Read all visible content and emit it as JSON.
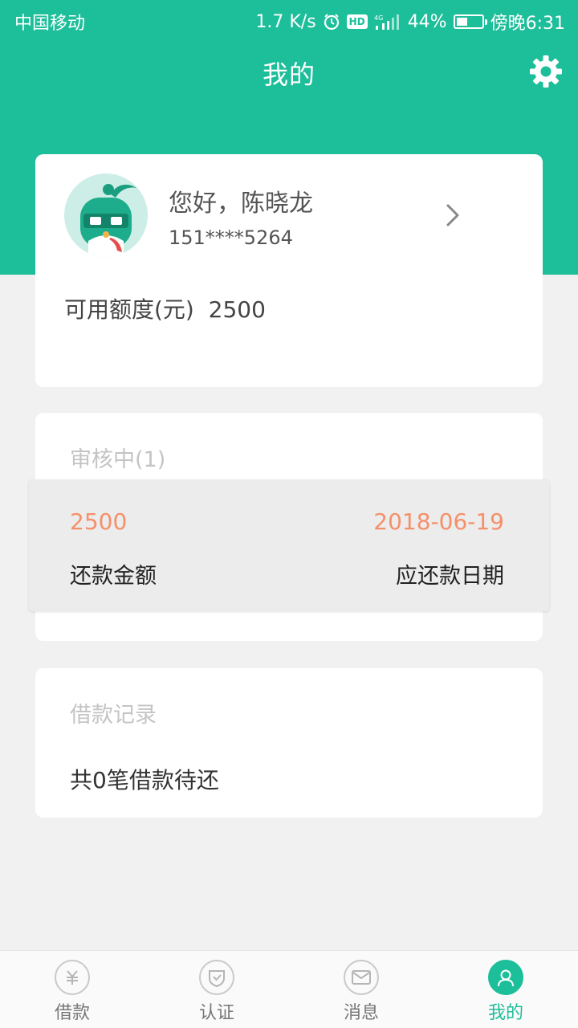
{
  "status_bar": {
    "carrier": "中国移动",
    "speed": "1.7 K/s",
    "hd": "HD",
    "network": "4G",
    "battery": "44%",
    "battery_level": 0.44,
    "time": "傍晚6:31"
  },
  "header": {
    "title": "我的",
    "settings_icon": "gear-icon"
  },
  "profile": {
    "greeting": "您好，陈晓龙",
    "phone": "151****5264",
    "credit_label": "可用额度(元)",
    "credit_value": "2500"
  },
  "review": {
    "heading": "审核中(1)",
    "amount_value": "2500",
    "amount_label": "还款金额",
    "date_value": "2018-06-19",
    "date_label": "应还款日期"
  },
  "records": {
    "heading": "借款记录",
    "summary": "共0笔借款待还"
  },
  "bottom_nav": [
    {
      "label": "借款",
      "icon": "yuan-icon",
      "active": false
    },
    {
      "label": "认证",
      "icon": "shield-check-icon",
      "active": false
    },
    {
      "label": "消息",
      "icon": "mail-icon",
      "active": false
    },
    {
      "label": "我的",
      "icon": "user-icon",
      "active": true
    }
  ],
  "colors": {
    "brand": "#1dbe9a",
    "accent_orange": "#f5906a",
    "background": "#f1f1f1"
  }
}
